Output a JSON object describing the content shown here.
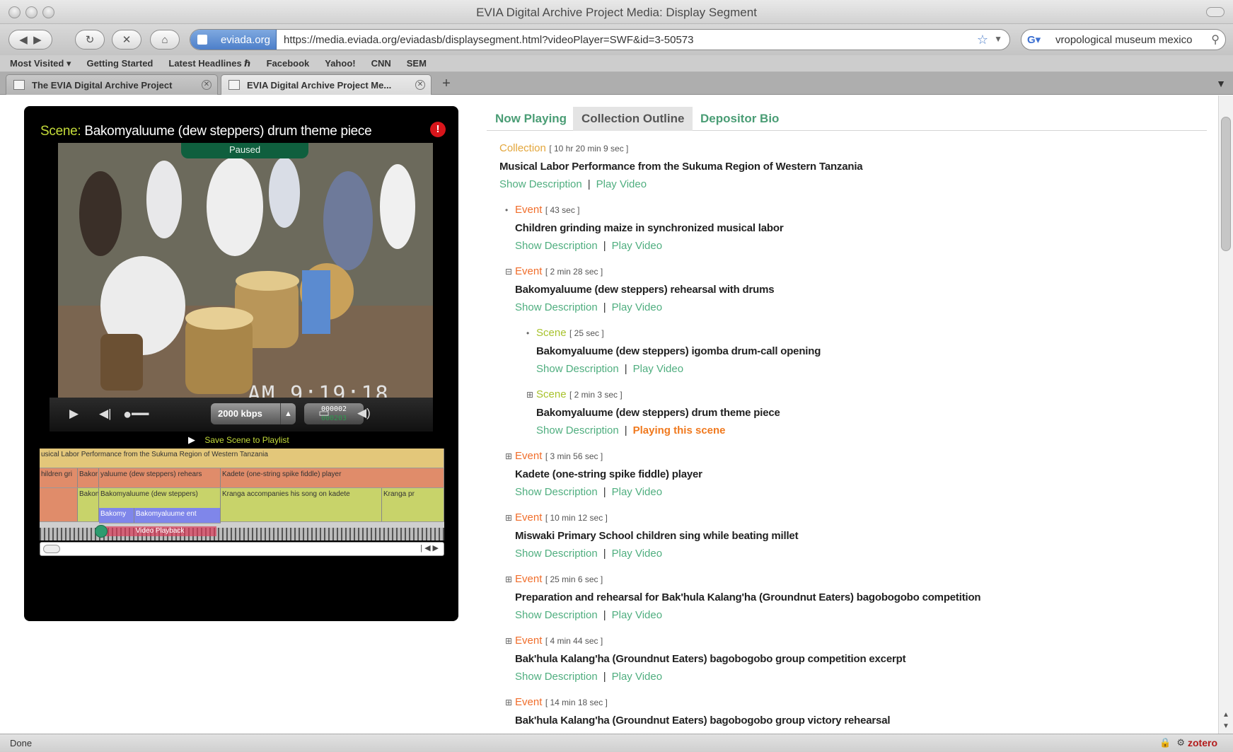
{
  "window": {
    "title": "EVIA Digital Archive Project Media: Display Segment"
  },
  "toolbar": {
    "back": "◀",
    "forward": "▶",
    "reload": "↻",
    "stop": "✕",
    "home": "⌂",
    "site_identity": "eviada.org",
    "url": "https://media.eviada.org/eviadasb/displaysegment.html?videoPlayer=SWF&id=3-50573",
    "search_value": "vropological museum mexico"
  },
  "bookmarks": [
    "Most Visited ▾",
    "Getting Started",
    "Latest Headlines ℏ",
    "Facebook",
    "Yahoo!",
    "CNN",
    "SEM"
  ],
  "tabs": [
    {
      "label": "The EVIA Digital Archive Project",
      "active": false
    },
    {
      "label": "EVIA Digital Archive Project Me...",
      "active": true
    }
  ],
  "player": {
    "scene_label": "Scene:",
    "scene_title": "Bakomyaluume (dew steppers) drum theme piece",
    "alert": "!",
    "paused_label": "Paused",
    "video_timestamp": "AM   9:19:18",
    "bitrate": "2000 kbps",
    "counter_top": "000002",
    "counter_bottom": "000203",
    "save_scene": "Save Scene to Playlist",
    "playback_label": "Video Playback",
    "timeline": {
      "row1": [
        "usical Labor Performance from the Sukuma Region of Western Tanzania"
      ],
      "row2": [
        "hildren gri",
        "Bakor",
        "yaluume (dew steppers) rehears",
        "Kadete (one-string spike fiddle) player"
      ],
      "row3": [
        "",
        "Bakon",
        "Bakomyaluume (dew steppers)",
        "Kranga accompanies his song on kadete",
        "Kranga pr"
      ],
      "row4": [
        "Bakomy",
        "Bakomyaluume ent"
      ]
    }
  },
  "outline_tabs": [
    "Now Playing",
    "Collection Outline",
    "Depositor Bio"
  ],
  "outline": {
    "show_description": "Show Description",
    "play_video": "Play Video",
    "playing_scene": "Playing this scene",
    "items": [
      {
        "kind": "Collection",
        "duration": "[ 10 hr 20 min 9 sec ]",
        "title": "Musical Labor Performance from the Sukuma Region of Western Tanzania",
        "marker": "",
        "playing": false
      },
      {
        "kind": "Event",
        "duration": "[ 43 sec ]",
        "title": "Children grinding maize in synchronized musical labor",
        "marker": "•",
        "playing": false
      },
      {
        "kind": "Event",
        "duration": "[ 2 min 28 sec ]",
        "title": "Bakomyaluume (dew steppers) rehearsal with drums",
        "marker": "⊟",
        "playing": false
      },
      {
        "kind": "Scene",
        "duration": "[ 25 sec ]",
        "title": "Bakomyaluume (dew steppers) igomba drum-call opening",
        "marker": "•",
        "playing": false
      },
      {
        "kind": "Scene",
        "duration": "[ 2 min 3 sec ]",
        "title": "Bakomyaluume (dew steppers) drum theme piece",
        "marker": "⊞",
        "playing": true
      },
      {
        "kind": "Event",
        "duration": "[ 3 min 56 sec ]",
        "title": "Kadete (one-string spike fiddle) player",
        "marker": "⊞",
        "playing": false
      },
      {
        "kind": "Event",
        "duration": "[ 10 min 12 sec ]",
        "title": "Miswaki Primary School children sing while beating millet",
        "marker": "⊞",
        "playing": false
      },
      {
        "kind": "Event",
        "duration": "[ 25 min 6 sec ]",
        "title": "Preparation and rehearsal for Bak'hula Kalang'ha (Groundnut Eaters) bagobogobo competition",
        "marker": "⊞",
        "playing": false
      },
      {
        "kind": "Event",
        "duration": "[ 4 min 44 sec ]",
        "title": "Bak'hula Kalang'ha (Groundnut Eaters) bagobogobo group competition excerpt",
        "marker": "⊞",
        "playing": false
      },
      {
        "kind": "Event",
        "duration": "[ 14 min 18 sec ]",
        "title": "Bak'hula Kalang'ha (Groundnut Eaters) bagobogobo group victory rehearsal",
        "marker": "⊞",
        "playing": false
      }
    ]
  },
  "status": {
    "text": "Done",
    "zotero": "zotero"
  },
  "colors": {
    "collection": "#e3a63b",
    "event": "#f06d2a",
    "scene": "#a8c22c",
    "link": "#4fae7f",
    "playing": "#f0791e"
  }
}
